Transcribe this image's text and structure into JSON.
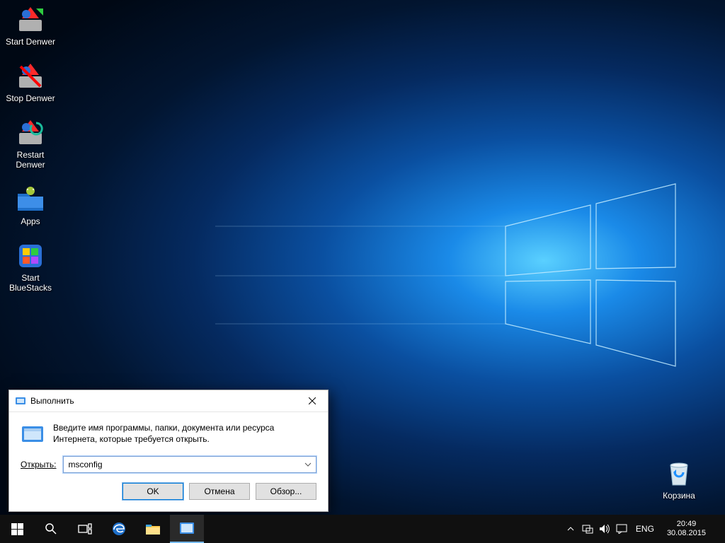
{
  "desktop_icons": [
    {
      "label": "Start Denwer"
    },
    {
      "label": "Stop Denwer"
    },
    {
      "label": "Restart Denwer"
    },
    {
      "label": "Apps"
    },
    {
      "label": "Start BlueStacks"
    }
  ],
  "recycle_bin_label": "Корзина",
  "run_dialog": {
    "title": "Выполнить",
    "description": "Введите имя программы, папки, документа или ресурса Интернета, которые требуется открыть.",
    "open_label": "Открыть:",
    "input_value": "msconfig",
    "ok": "OK",
    "cancel": "Отмена",
    "browse": "Обзор..."
  },
  "tray": {
    "lang": "ENG",
    "time": "20:49",
    "date": "30.08.2015"
  }
}
